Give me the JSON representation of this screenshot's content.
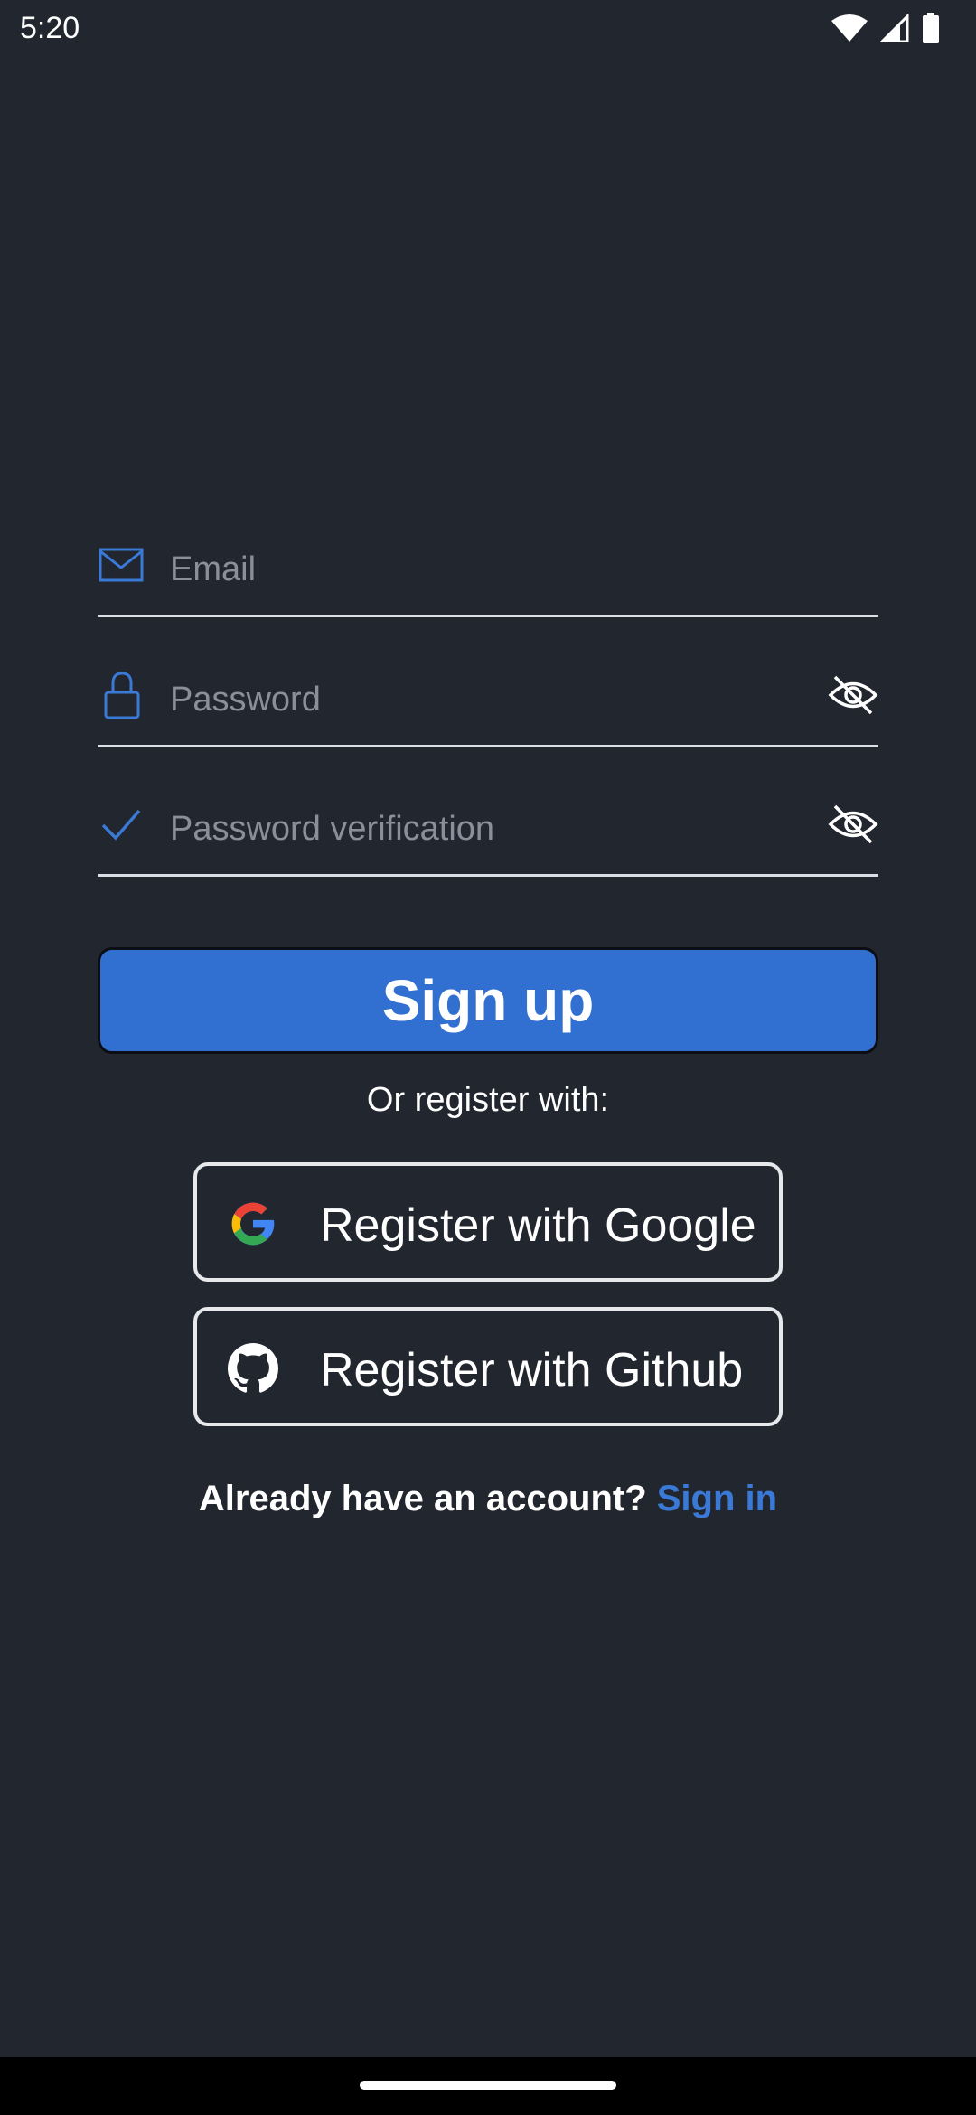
{
  "status_bar": {
    "time": "5:20",
    "icons": [
      "wifi-icon",
      "signal-icon",
      "battery-icon"
    ]
  },
  "form": {
    "email": {
      "placeholder": "Email",
      "value": "",
      "icon": "mail-icon"
    },
    "password": {
      "placeholder": "Password",
      "value": "",
      "icon": "lock-icon",
      "toggle_icon": "eye-off-icon"
    },
    "password_verification": {
      "placeholder": "Password verification",
      "value": "",
      "icon": "check-icon",
      "toggle_icon": "eye-off-icon"
    }
  },
  "signup_button": {
    "label": "Sign up"
  },
  "social": {
    "or_text": "Or register with:",
    "google_label": "Register with Google",
    "github_label": "Register with Github"
  },
  "footer": {
    "question": "Already have an account?",
    "signin_label": "Sign in"
  },
  "colors": {
    "background": "#22262f",
    "accent": "#3170d0",
    "link": "#3a79d6",
    "placeholder": "#8a8f99",
    "divider": "#d9dde4"
  }
}
